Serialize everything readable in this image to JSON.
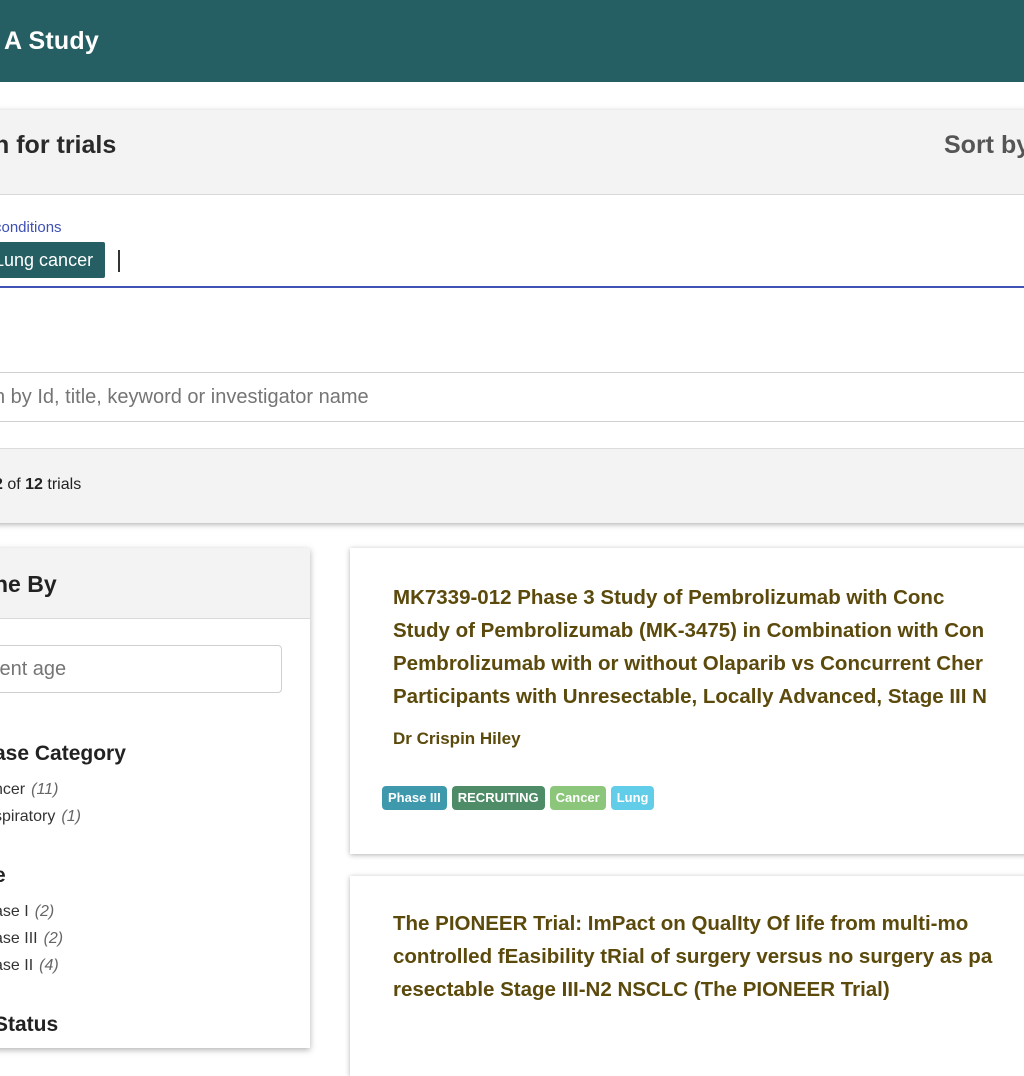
{
  "header": {
    "title": "A Study"
  },
  "search": {
    "title": "n for trials",
    "sort_label": "Sort by",
    "conditions_label": "conditions",
    "chip_label": "Lung cancer",
    "keyword_placeholder": "n by Id, title, keyword or investigator name",
    "results": {
      "from": "2",
      "of_label": "of",
      "total": "12",
      "suffix": "trials"
    }
  },
  "refine": {
    "title": "ne By",
    "age_placeholder": "ient age",
    "facets": [
      {
        "title": "ase Category",
        "items": [
          {
            "label": "ncer",
            "count": "(11)"
          },
          {
            "label": "spiratory",
            "count": "(1)"
          }
        ]
      },
      {
        "title": "e",
        "items": [
          {
            "label": "ase I",
            "count": "(2)"
          },
          {
            "label": "ase III",
            "count": "(2)"
          },
          {
            "label": "ase II",
            "count": "(4)"
          }
        ]
      },
      {
        "title": "Status",
        "items": []
      }
    ]
  },
  "trials": [
    {
      "title_lines": [
        "MK7339-012 Phase 3 Study of Pembrolizumab with Conc",
        "Study of Pembrolizumab (MK-3475) in Combination with Con",
        "Pembrolizumab with or without Olaparib vs Concurrent Cher",
        "Participants with Unresectable, Locally Advanced, Stage III N"
      ],
      "investigator": "Dr Crispin Hiley",
      "tags": [
        "Phase III",
        "RECRUITING",
        "Cancer",
        "Lung"
      ]
    },
    {
      "title_lines": [
        "The PIONEER Trial:  ImPact on QualIty Of life from multi-mo",
        "controlled fEasibility tRial of surgery versus no surgery as pa",
        "resectable Stage III-N2 NSCLC (The PIONEER Trial)"
      ]
    }
  ],
  "colors": {
    "header_bg": "#255f63",
    "accent": "#3f51b5",
    "title_text": "#5b4a0c",
    "tag_phase": "#3e99ad",
    "tag_status": "#4e8b67",
    "tag_cancer": "#8cc67b",
    "tag_lung": "#62cde8"
  }
}
